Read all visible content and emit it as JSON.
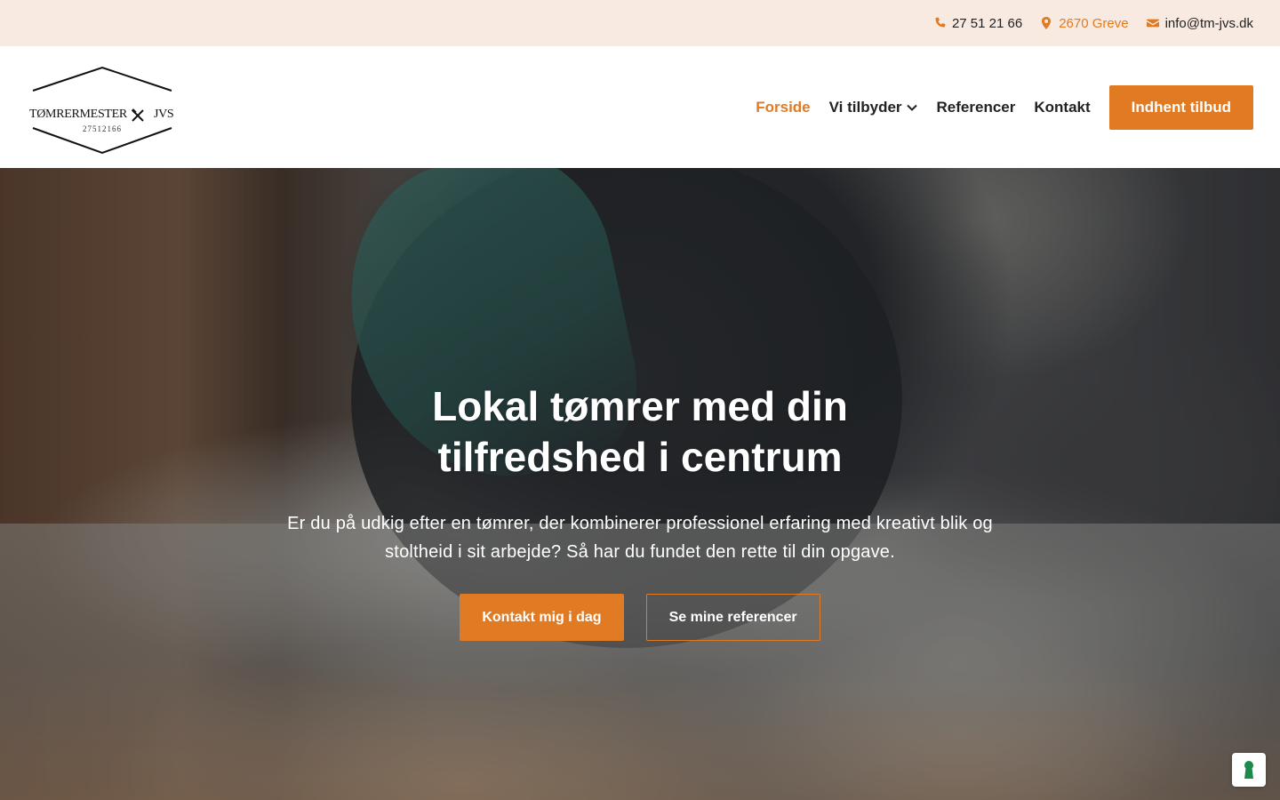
{
  "topbar": {
    "phone": "27 51 21 66",
    "location": "2670 Greve",
    "email": "info@tm-jvs.dk"
  },
  "logo": {
    "name_left": "TØMRERMESTER",
    "name_right": "JVS",
    "number": "27512166"
  },
  "nav": {
    "items": [
      {
        "label": "Forside",
        "active": true
      },
      {
        "label": "Vi tilbyder",
        "dropdown": true
      },
      {
        "label": "Referencer"
      },
      {
        "label": "Kontakt"
      }
    ],
    "cta_label": "Indhent tilbud"
  },
  "hero": {
    "title": "Lokal tømrer med din tilfredshed i centrum",
    "subtitle": "Er du på udkig efter en tømrer, der kombinerer professionel erfaring med kreativt blik og stoltheid i sit arbejde? Så har du fundet den rette til din opgave.",
    "primary_button": "Kontakt mig i dag",
    "secondary_button": "Se mine referencer"
  },
  "icons": {
    "phone": "phone-icon",
    "location": "map-pin-icon",
    "email": "envelope-icon",
    "dropdown": "chevron-down-icon",
    "cookie": "keyhole-icon"
  },
  "colors": {
    "accent": "#e07a23",
    "topbar_bg": "#f8e9e1",
    "cookie_icon": "#1b8a4a"
  }
}
